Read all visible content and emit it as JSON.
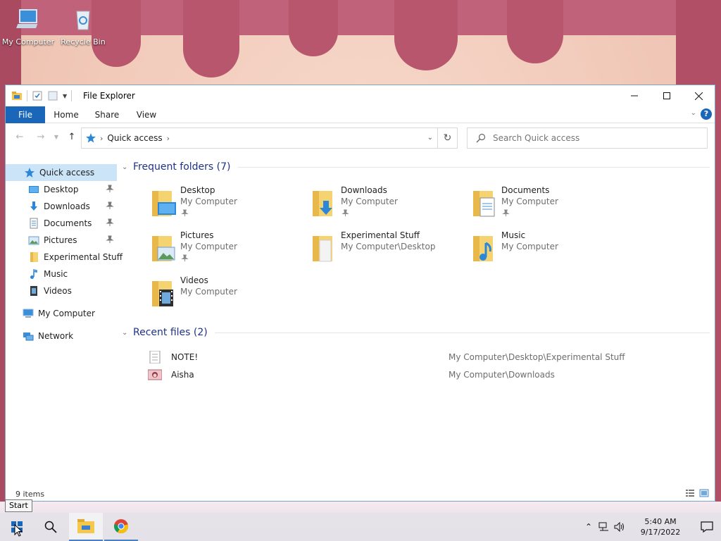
{
  "desktop": {
    "icons": [
      {
        "label": "My Computer",
        "icon": "computer-icon"
      },
      {
        "label": "Recycle Bin",
        "icon": "recycle-bin-icon"
      }
    ]
  },
  "window": {
    "title": "File Explorer",
    "ribbon_tabs": [
      "File",
      "Home",
      "Share",
      "View"
    ],
    "help": "?",
    "address": {
      "location": "Quick access"
    },
    "search": {
      "placeholder": "Search Quick access"
    }
  },
  "navpane": {
    "items": [
      {
        "label": "Quick access",
        "icon": "quick-access-star-icon"
      },
      {
        "label": "Desktop",
        "icon": "desktop-icon"
      },
      {
        "label": "Downloads",
        "icon": "downloads-icon"
      },
      {
        "label": "Documents",
        "icon": "documents-icon"
      },
      {
        "label": "Pictures",
        "icon": "pictures-icon"
      },
      {
        "label": "Experimental Stuff",
        "icon": "folder-icon"
      },
      {
        "label": "Music",
        "icon": "music-icon"
      },
      {
        "label": "Videos",
        "icon": "videos-icon"
      },
      {
        "label": "My Computer",
        "icon": "computer-icon"
      },
      {
        "label": "Network",
        "icon": "network-icon"
      }
    ]
  },
  "frequent": {
    "title": "Frequent folders (7)",
    "folders": [
      {
        "name": "Desktop",
        "location": "My Computer",
        "icon": "desktop-folder-icon"
      },
      {
        "name": "Downloads",
        "location": "My Computer",
        "icon": "downloads-folder-icon"
      },
      {
        "name": "Documents",
        "location": "My Computer",
        "icon": "documents-folder-icon"
      },
      {
        "name": "Pictures",
        "location": "My Computer",
        "icon": "pictures-folder-icon"
      },
      {
        "name": "Experimental Stuff",
        "location": "My Computer\\Desktop",
        "icon": "folder-icon"
      },
      {
        "name": "Music",
        "location": "My Computer",
        "icon": "music-folder-icon"
      },
      {
        "name": "Videos",
        "location": "My Computer",
        "icon": "videos-folder-icon"
      }
    ]
  },
  "recent": {
    "title": "Recent files (2)",
    "files": [
      {
        "name": "NOTE!",
        "path": "My Computer\\Desktop\\Experimental Stuff",
        "icon": "text-file-icon"
      },
      {
        "name": "Aisha",
        "path": "My Computer\\Downloads",
        "icon": "image-file-icon"
      }
    ]
  },
  "status": {
    "items": "9 items"
  },
  "taskbar": {
    "tooltip": "Start",
    "time": "5:40 AM",
    "date": "9/17/2022"
  },
  "colors": {
    "accent": "#1a66b8",
    "group_title": "#1e3287",
    "selection": "#cce4f7"
  }
}
